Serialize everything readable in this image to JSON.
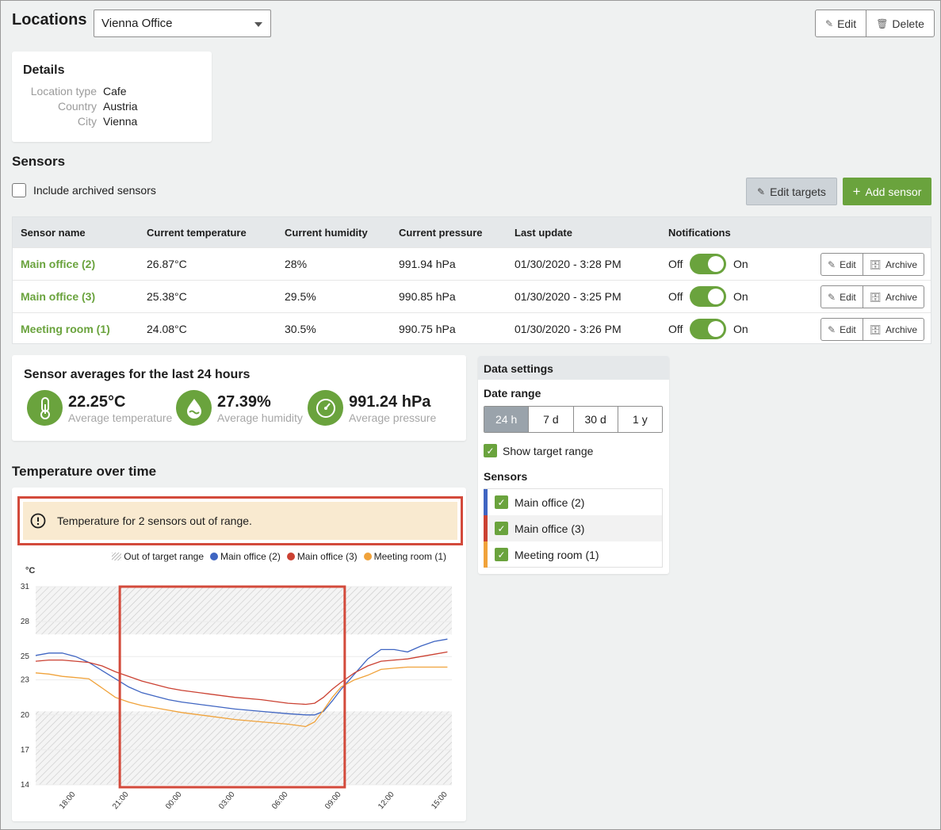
{
  "page": {
    "title": "Locations",
    "location_select": "Vienna Office",
    "edit_label": "Edit",
    "delete_label": "Delete"
  },
  "details": {
    "title": "Details",
    "rows": [
      {
        "key": "Location type",
        "value": "Cafe"
      },
      {
        "key": "Country",
        "value": "Austria"
      },
      {
        "key": "City",
        "value": "Vienna"
      }
    ]
  },
  "sensors": {
    "title": "Sensors",
    "include_archived": "Include archived sensors",
    "edit_targets": "Edit targets",
    "add_sensor": "Add sensor",
    "columns": [
      "Sensor name",
      "Current temperature",
      "Current humidity",
      "Current pressure",
      "Last update",
      "Notifications"
    ],
    "rows": [
      {
        "name": "Main office (2)",
        "temp": "26.87°C",
        "humidity": "28%",
        "pressure": "991.94 hPa",
        "updated": "01/30/2020 - 3:28 PM",
        "off": "Off",
        "on": "On",
        "edit": "Edit",
        "archive": "Archive"
      },
      {
        "name": "Main office (3)",
        "temp": "25.38°C",
        "humidity": "29.5%",
        "pressure": "990.85 hPa",
        "updated": "01/30/2020 - 3:25 PM",
        "off": "Off",
        "on": "On",
        "edit": "Edit",
        "archive": "Archive"
      },
      {
        "name": "Meeting room (1)",
        "temp": "24.08°C",
        "humidity": "30.5%",
        "pressure": "990.75 hPa",
        "updated": "01/30/2020 - 3:26 PM",
        "off": "Off",
        "on": "On",
        "edit": "Edit",
        "archive": "Archive"
      }
    ]
  },
  "averages": {
    "title": "Sensor averages for the last 24 hours",
    "items": [
      {
        "value": "22.25°C",
        "label": "Average temperature",
        "icon": "thermometer-icon"
      },
      {
        "value": "27.39%",
        "label": "Average humidity",
        "icon": "humidity-drop-icon"
      },
      {
        "value": "991.24 hPa",
        "label": "Average pressure",
        "icon": "gauge-icon"
      }
    ]
  },
  "chart_section": {
    "title": "Temperature over time",
    "alert": "Temperature for 2 sensors out of range."
  },
  "settings": {
    "title": "Data settings",
    "date_range_label": "Date range",
    "ranges": [
      "24 h",
      "7 d",
      "30 d",
      "1 y"
    ],
    "active_range": "24 h",
    "show_target": "Show target range",
    "sensors_label": "Sensors",
    "sensors": [
      {
        "name": "Main office (2)",
        "color": "#3f65c2",
        "checked": true
      },
      {
        "name": "Main office (3)",
        "color": "#cb4132",
        "checked": true
      },
      {
        "name": "Meeting room (1)",
        "color": "#f0a23a",
        "checked": true
      }
    ]
  },
  "colors": {
    "accent": "#6aa33d",
    "alert_border": "#d34a3b",
    "alert_bg": "#f9ead0"
  },
  "chart_data": {
    "type": "line",
    "ylabel": "°C",
    "y_ticks": [
      31,
      28,
      25,
      23,
      20,
      17,
      14
    ],
    "ylim": [
      14,
      31
    ],
    "x_ticks": [
      "18:00",
      "21:00",
      "00:00",
      "03:00",
      "06:00",
      "09:00",
      "12:00",
      "15:00"
    ],
    "x_range_hours": [
      15.75,
      39.25
    ],
    "target_range": [
      20.3,
      26.9
    ],
    "legend": [
      "Out of target range",
      "Main office (2)",
      "Main office (3)",
      "Meeting room (1)"
    ],
    "highlight_window_hours": [
      20.5,
      33.2
    ],
    "series": [
      {
        "name": "Main office (2)",
        "color": "#3f65c2",
        "x": [
          15.75,
          16.5,
          17.25,
          18,
          18.75,
          19.5,
          20.25,
          21,
          21.75,
          22.5,
          23.25,
          24,
          25.5,
          27,
          28.5,
          30,
          31,
          31.5,
          32,
          32.5,
          33,
          33.75,
          34.5,
          35.25,
          36,
          36.75,
          37.5,
          38.25,
          39
        ],
        "y": [
          25.1,
          25.3,
          25.3,
          25.0,
          24.5,
          23.8,
          23.1,
          22.4,
          21.9,
          21.6,
          21.3,
          21.1,
          20.8,
          20.5,
          20.3,
          20.1,
          20.0,
          20.0,
          20.3,
          21.2,
          22.2,
          23.5,
          24.8,
          25.6,
          25.6,
          25.4,
          25.9,
          26.3,
          26.5
        ]
      },
      {
        "name": "Main office (3)",
        "color": "#cb4132",
        "x": [
          15.75,
          16.5,
          17.25,
          18,
          18.75,
          19.5,
          20.25,
          21,
          21.75,
          22.5,
          23.25,
          24,
          25.5,
          27,
          28.5,
          30,
          31,
          31.5,
          32,
          32.5,
          33,
          33.75,
          34.5,
          35.25,
          36,
          36.75,
          37.5,
          38.25,
          39
        ],
        "y": [
          24.6,
          24.7,
          24.7,
          24.6,
          24.5,
          24.2,
          23.7,
          23.3,
          22.9,
          22.6,
          22.3,
          22.1,
          21.8,
          21.5,
          21.3,
          21.0,
          20.9,
          21.0,
          21.5,
          22.2,
          22.8,
          23.6,
          24.2,
          24.6,
          24.7,
          24.8,
          25.0,
          25.2,
          25.4
        ]
      },
      {
        "name": "Meeting room (1)",
        "color": "#f0a23a",
        "x": [
          15.75,
          16.5,
          17.25,
          18,
          18.75,
          19.5,
          20.25,
          21,
          21.75,
          22.5,
          23.25,
          24,
          25.5,
          27,
          28.5,
          30,
          31,
          31.5,
          32,
          32.5,
          33,
          33.75,
          34.5,
          35.25,
          36,
          36.75,
          37.5,
          38.25,
          39
        ],
        "y": [
          23.6,
          23.5,
          23.3,
          23.2,
          23.1,
          22.3,
          21.5,
          21.1,
          20.8,
          20.6,
          20.4,
          20.2,
          19.9,
          19.6,
          19.4,
          19.2,
          19.0,
          19.4,
          20.4,
          21.5,
          22.4,
          23.0,
          23.4,
          23.9,
          24.0,
          24.1,
          24.1,
          24.1,
          24.1
        ]
      }
    ]
  }
}
